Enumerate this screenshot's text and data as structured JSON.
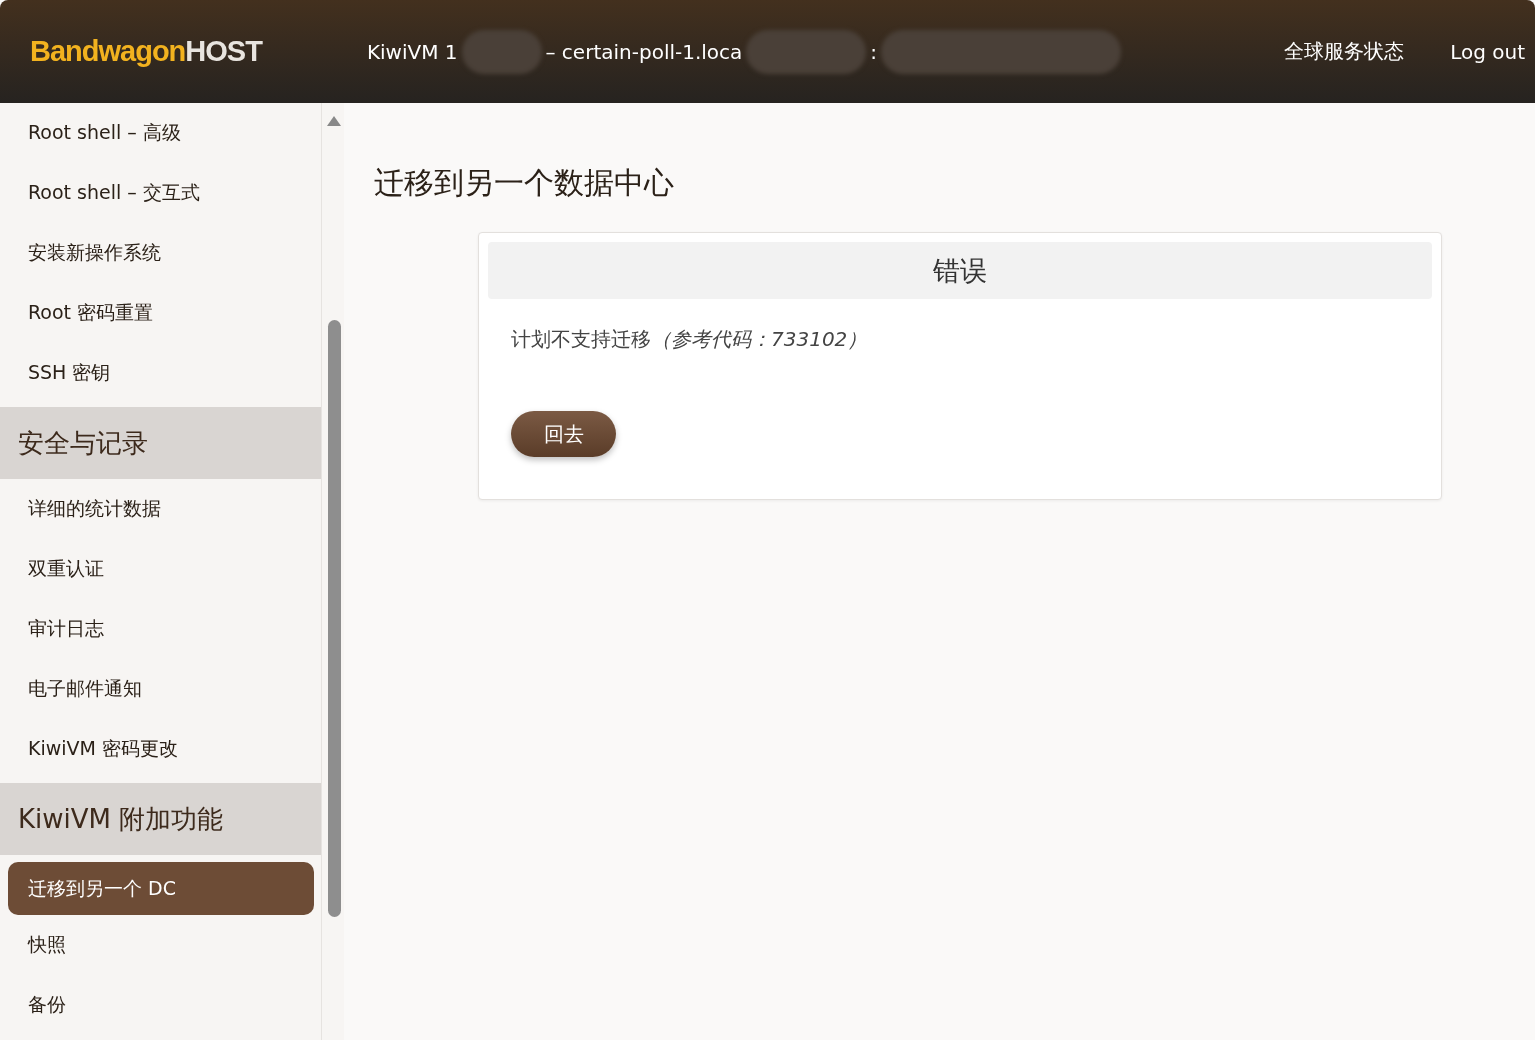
{
  "header": {
    "logo": {
      "part_1": "Bandwagon",
      "part_2": "HOST"
    },
    "title_fragments": [
      "KiwiVM 1",
      "– certain-poll-1.loca",
      ":"
    ],
    "links": [
      "全球服务状态",
      "Log out"
    ]
  },
  "sidebar": {
    "items": [
      {
        "kind": "item",
        "label": "Root shell – 高级",
        "selected": false
      },
      {
        "kind": "item",
        "label": "Root shell – 交互式",
        "selected": false
      },
      {
        "kind": "item",
        "label": "安装新操作系统",
        "selected": false
      },
      {
        "kind": "item",
        "label": "Root 密码重置",
        "selected": false
      },
      {
        "kind": "item",
        "label": "SSH 密钥",
        "selected": false
      },
      {
        "kind": "section",
        "label": "安全与记录"
      },
      {
        "kind": "item",
        "label": "详细的统计数据",
        "selected": false
      },
      {
        "kind": "item",
        "label": "双重认证",
        "selected": false
      },
      {
        "kind": "item",
        "label": "审计日志",
        "selected": false
      },
      {
        "kind": "item",
        "label": "电子邮件通知",
        "selected": false
      },
      {
        "kind": "item",
        "label": "KiwiVM 密码更改",
        "selected": false
      },
      {
        "kind": "section",
        "label": "KiwiVM 附加功能"
      },
      {
        "kind": "item",
        "label": "迁移到另一个 DC",
        "selected": true
      },
      {
        "kind": "item",
        "label": "快照",
        "selected": false
      },
      {
        "kind": "item",
        "label": "备份",
        "selected": false
      }
    ]
  },
  "page": {
    "title": "迁移到另一个数据中心",
    "card": {
      "title": "错误",
      "message": "计划不支持迁移",
      "code_note": "（参考代码：733102）",
      "button": "回去"
    }
  }
}
